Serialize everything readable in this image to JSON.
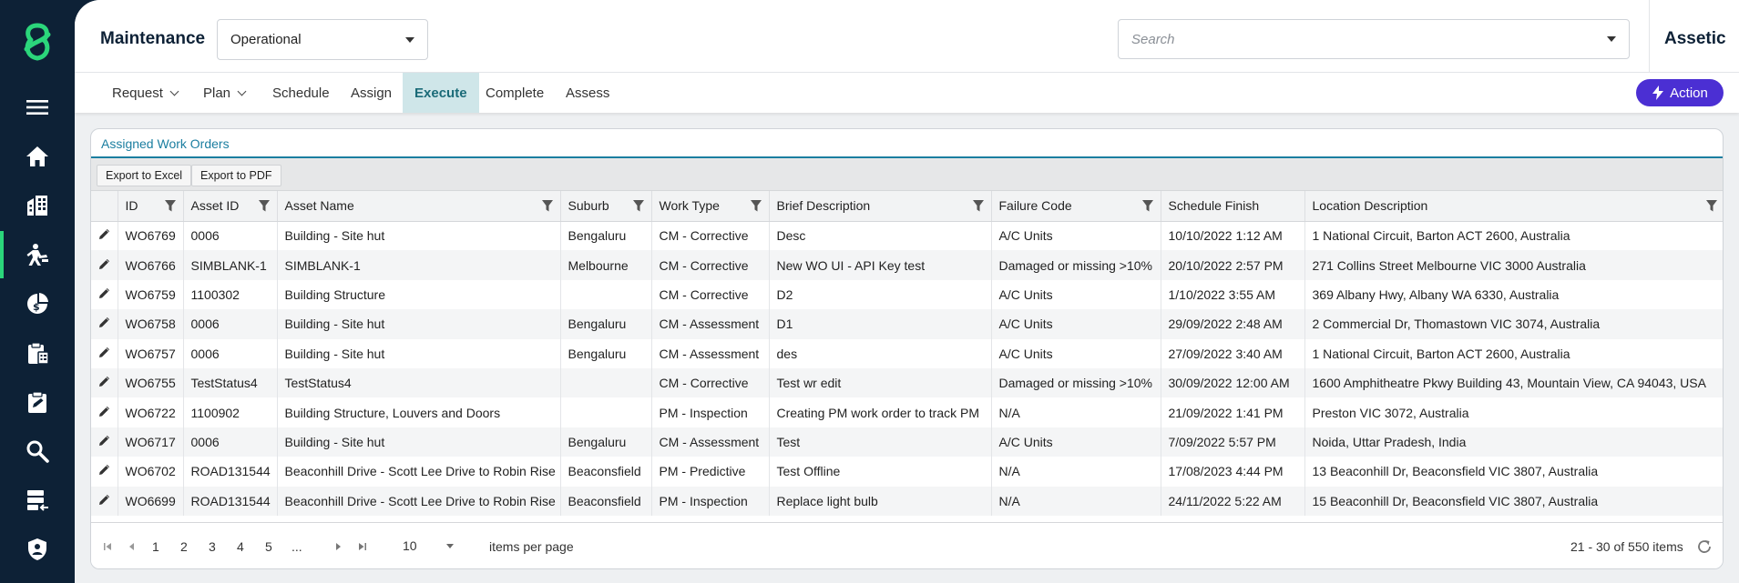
{
  "header": {
    "module_title": "Maintenance",
    "status_select": "Operational",
    "search_placeholder": "Search",
    "brand": "Assetic"
  },
  "sidebar": {
    "items": [
      {
        "icon": "menu-icon"
      },
      {
        "icon": "home-icon"
      },
      {
        "icon": "buildings-icon"
      },
      {
        "icon": "maintenance-worker-icon",
        "active": true
      },
      {
        "icon": "finance-icon"
      },
      {
        "icon": "clipboard-list-icon"
      },
      {
        "icon": "clipboard-edit-icon"
      },
      {
        "icon": "search-icon"
      },
      {
        "icon": "server-import-icon"
      },
      {
        "icon": "shield-user-icon"
      }
    ]
  },
  "nav": {
    "tabs": [
      {
        "label": "Request",
        "dropdown": true
      },
      {
        "label": "Plan",
        "dropdown": true
      },
      {
        "label": "Schedule"
      },
      {
        "label": "Assign"
      },
      {
        "label": "Execute",
        "active": true
      },
      {
        "label": "Complete"
      },
      {
        "label": "Assess"
      }
    ],
    "action_label": "Action"
  },
  "panel": {
    "title": "Assigned Work Orders",
    "export_excel": "Export to Excel",
    "export_pdf": "Export to PDF"
  },
  "table": {
    "columns": [
      "ID",
      "Asset ID",
      "Asset Name",
      "Suburb",
      "Work Type",
      "Brief Description",
      "Failure Code",
      "Schedule Finish",
      "Location Description"
    ],
    "rows": [
      [
        "WO6769",
        "0006",
        "Building - Site hut",
        "Bengaluru",
        "CM - Corrective",
        "Desc",
        "A/C Units",
        "10/10/2022 1:12 AM",
        "1 National Circuit, Barton ACT 2600, Australia"
      ],
      [
        "WO6766",
        "SIMBLANK-1",
        "SIMBLANK-1",
        "Melbourne",
        "CM - Corrective",
        "New WO UI - API Key test",
        "Damaged or missing >10%",
        "20/10/2022 2:57 PM",
        "271 Collins Street Melbourne VIC 3000 Australia"
      ],
      [
        "WO6759",
        "1100302",
        "Building Structure",
        "",
        "CM - Corrective",
        "D2",
        "A/C Units",
        "1/10/2022 3:55 AM",
        "369 Albany Hwy, Albany WA 6330, Australia"
      ],
      [
        "WO6758",
        "0006",
        "Building - Site hut",
        "Bengaluru",
        "CM - Assessment",
        "D1",
        "A/C Units",
        "29/09/2022 2:48 AM",
        "2 Commercial Dr, Thomastown VIC 3074, Australia"
      ],
      [
        "WO6757",
        "0006",
        "Building - Site hut",
        "Bengaluru",
        "CM - Assessment",
        "des",
        "A/C Units",
        "27/09/2022 3:40 AM",
        "1 National Circuit, Barton ACT 2600, Australia"
      ],
      [
        "WO6755",
        "TestStatus4",
        "TestStatus4",
        "",
        "CM - Corrective",
        "Test wr edit",
        "Damaged or missing >10%",
        "30/09/2022 12:00 AM",
        "1600 Amphitheatre Pkwy Building 43, Mountain View, CA 94043, USA"
      ],
      [
        "WO6722",
        "1100902",
        "Building Structure, Louvers and Doors",
        "",
        "PM - Inspection",
        "Creating PM work order to track PM",
        "N/A",
        "21/09/2022 1:41 PM",
        "Preston VIC 3072, Australia"
      ],
      [
        "WO6717",
        "0006",
        "Building - Site hut",
        "Bengaluru",
        "CM - Assessment",
        "Test",
        "A/C Units",
        "7/09/2022 5:57 PM",
        "Noida, Uttar Pradesh, India"
      ],
      [
        "WO6702",
        "ROAD131544",
        "Beaconhill Drive - Scott Lee Drive to Robin Rise",
        "Beaconsfield",
        "PM - Predictive",
        "Test Offline",
        "N/A",
        "17/08/2023 4:44 PM",
        "13 Beaconhill Dr, Beaconsfield VIC 3807, Australia"
      ],
      [
        "WO6699",
        "ROAD131544",
        "Beaconhill Drive - Scott Lee Drive to Robin Rise",
        "Beaconsfield",
        "PM - Inspection",
        "Replace light bulb",
        "N/A",
        "24/11/2022 5:22 AM",
        "15 Beaconhill Dr, Beaconsfield VIC 3807, Australia"
      ]
    ]
  },
  "pager": {
    "pages": [
      "1",
      "2",
      "3",
      "4",
      "5",
      "..."
    ],
    "per_page": "10",
    "per_page_label": "items per page",
    "info": "21 - 30 of 550 items"
  },
  "colors": {
    "sidebar_bg": "#0d2136",
    "logo_accent": "#2bd67b",
    "active_tab_bg": "#cfe6e9",
    "action_button": "#4b2fd3",
    "panel_title": "#1b7ea0"
  }
}
